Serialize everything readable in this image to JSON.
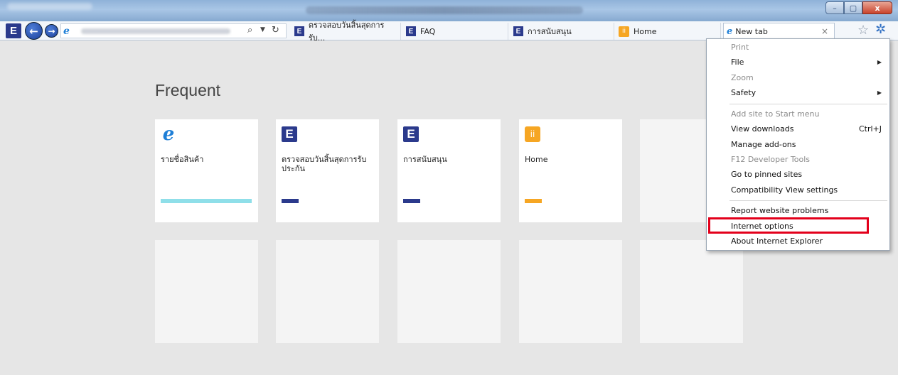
{
  "toolbar": {
    "tabs": [
      {
        "label": "ตรวจสอบวันสิ้นสุดการรับ..."
      },
      {
        "label": "FAQ"
      },
      {
        "label": "การสนับสนุน"
      },
      {
        "label": "Home"
      },
      {
        "label": "New tab"
      }
    ],
    "close_tab_glyph": "×",
    "window_buttons": {
      "minimize": "–",
      "maximize": "▢",
      "close": "x"
    },
    "logo_letter": "E"
  },
  "content": {
    "heading": "Frequent",
    "tiles": [
      {
        "label": "รายชื่อสินค้า",
        "icon": "ie-icon",
        "bar_color": "#8fdfe9",
        "bar_width": 128
      },
      {
        "label": "ตรวจสอบวันสิ้นสุดการรับประกัน",
        "icon": "e-icon",
        "bar_color": "#2b3a8c",
        "bar_width": 24
      },
      {
        "label": "การสนับสนุน",
        "icon": "e-icon",
        "bar_color": "#2b3a8c",
        "bar_width": 24
      },
      {
        "label": "Home",
        "icon": "home-icon",
        "bar_color": "#f6a623",
        "bar_width": 24
      }
    ]
  },
  "menu": {
    "items": [
      {
        "label": "Print",
        "disabled": true
      },
      {
        "label": "File",
        "submenu": true
      },
      {
        "label": "Zoom",
        "disabled": true
      },
      {
        "label": "Safety",
        "submenu": true
      },
      {
        "label": "Add site to Start menu",
        "disabled": true
      },
      {
        "label": "View downloads",
        "shortcut": "Ctrl+J"
      },
      {
        "label": "Manage add-ons"
      },
      {
        "label": "F12 Developer Tools",
        "disabled": true
      },
      {
        "label": "Go to pinned sites"
      },
      {
        "label": "Compatibility View settings"
      },
      {
        "label": "Report website problems"
      },
      {
        "label": "Internet options",
        "highlighted": true
      },
      {
        "label": "About Internet Explorer"
      }
    ]
  },
  "colors": {
    "highlight": "#e3001b",
    "brand_e": "#2b3a8c"
  }
}
